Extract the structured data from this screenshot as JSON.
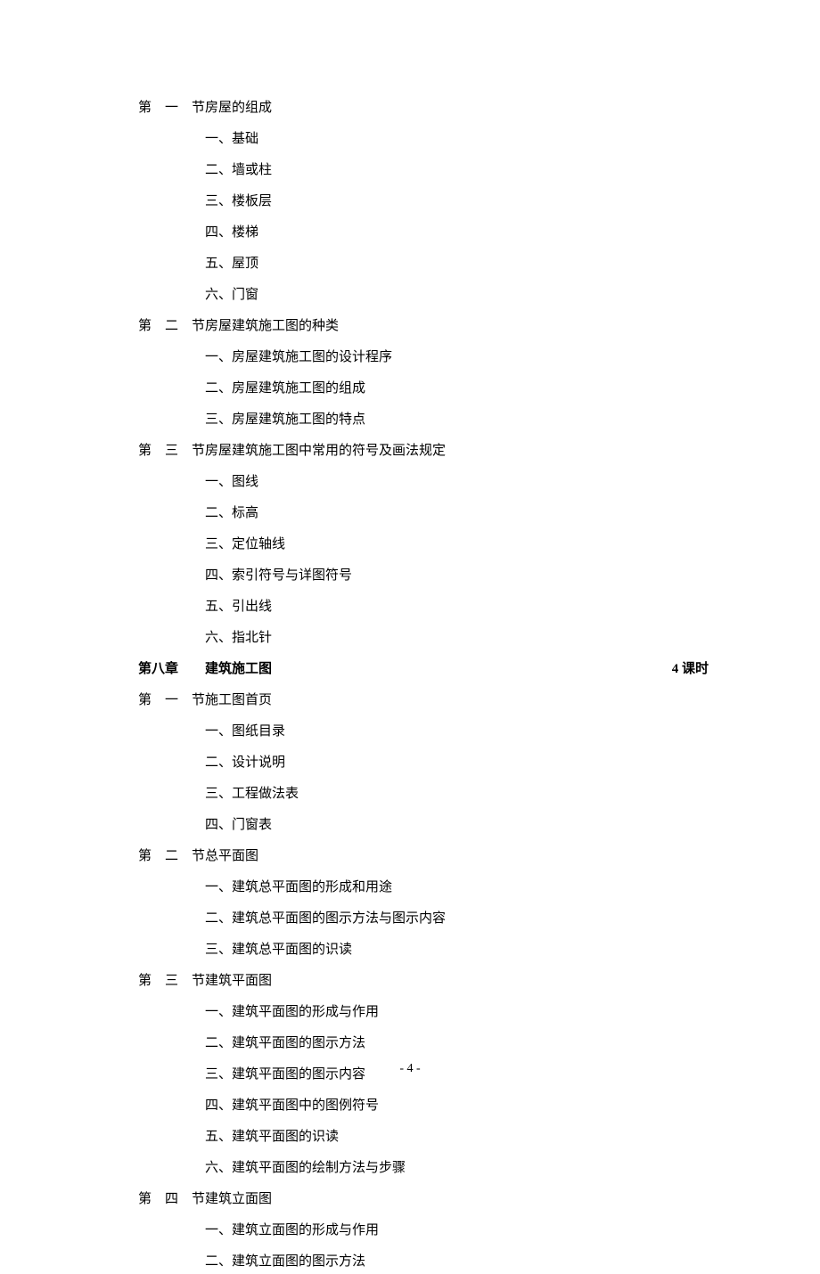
{
  "sections": [
    {
      "label": "第一节",
      "title": "房屋的组成",
      "items": [
        "一、基础",
        "二、墙或柱",
        "三、楼板层",
        "四、楼梯",
        "五、屋顶",
        "六、门窗"
      ]
    },
    {
      "label": "第二节",
      "title": "房屋建筑施工图的种类",
      "items": [
        "一、房屋建筑施工图的设计程序",
        "二、房屋建筑施工图的组成",
        "三、房屋建筑施工图的特点"
      ]
    },
    {
      "label": "第三节",
      "title": "房屋建筑施工图中常用的符号及画法规定",
      "items": [
        "一、图线",
        "二、标高",
        "三、定位轴线",
        "四、索引符号与详图符号",
        "五、引出线",
        "六、指北针"
      ]
    }
  ],
  "chapter": {
    "label": "第八章",
    "title": "建筑施工图",
    "duration": "4 课时"
  },
  "chapterSections": [
    {
      "label": "第一节",
      "title": "施工图首页",
      "items": [
        "一、图纸目录",
        "二、设计说明",
        "三、工程做法表",
        "四、门窗表"
      ]
    },
    {
      "label": "第二节",
      "title": "总平面图",
      "items": [
        "一、建筑总平面图的形成和用途",
        "二、建筑总平面图的图示方法与图示内容",
        "三、建筑总平面图的识读"
      ]
    },
    {
      "label": "第三节",
      "title": "建筑平面图",
      "items": [
        "一、建筑平面图的形成与作用",
        "二、建筑平面图的图示方法",
        "三、建筑平面图的图示内容",
        "四、建筑平面图中的图例符号",
        "五、建筑平面图的识读",
        "六、建筑平面图的绘制方法与步骤"
      ]
    },
    {
      "label": "第四节",
      "title": "建筑立面图",
      "items": [
        "一、建筑立面图的形成与作用",
        "二、建筑立面图的图示方法"
      ]
    }
  ],
  "pageNumber": "- 4 -"
}
